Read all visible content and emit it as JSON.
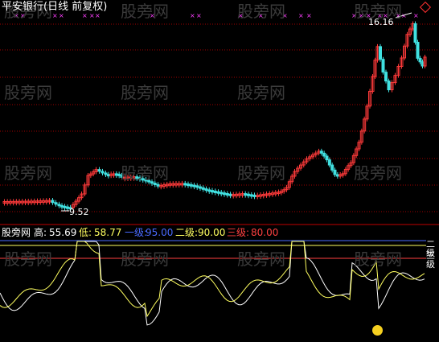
{
  "window": {
    "title": "平安银行(日线 前复权)"
  },
  "watermark": "股旁网",
  "main_chart": {
    "peak_label": "16.16",
    "low_label": "9.52",
    "colors": {
      "up": "#ff3a3a",
      "down": "#40e0e0",
      "grid": "#a00000"
    }
  },
  "indicator": {
    "name": "股旁网",
    "high": {
      "label": "高:",
      "value": "55.69",
      "color": "#ffffff"
    },
    "low": {
      "label": "低:",
      "value": "58.77",
      "color": "#ffff60"
    },
    "level1": {
      "label": "一级:",
      "value": "95.00",
      "color": "#4a6bff"
    },
    "level2": {
      "label": "二级:",
      "value": "90.00",
      "color": "#ffff60"
    },
    "level3": {
      "label": "三级:",
      "value": "80.00",
      "color": "#ff4040"
    },
    "right_labels": [
      "二级",
      "三级"
    ]
  },
  "icons": {
    "bottom": "face-icon",
    "top_right": "diamond-icon"
  }
}
